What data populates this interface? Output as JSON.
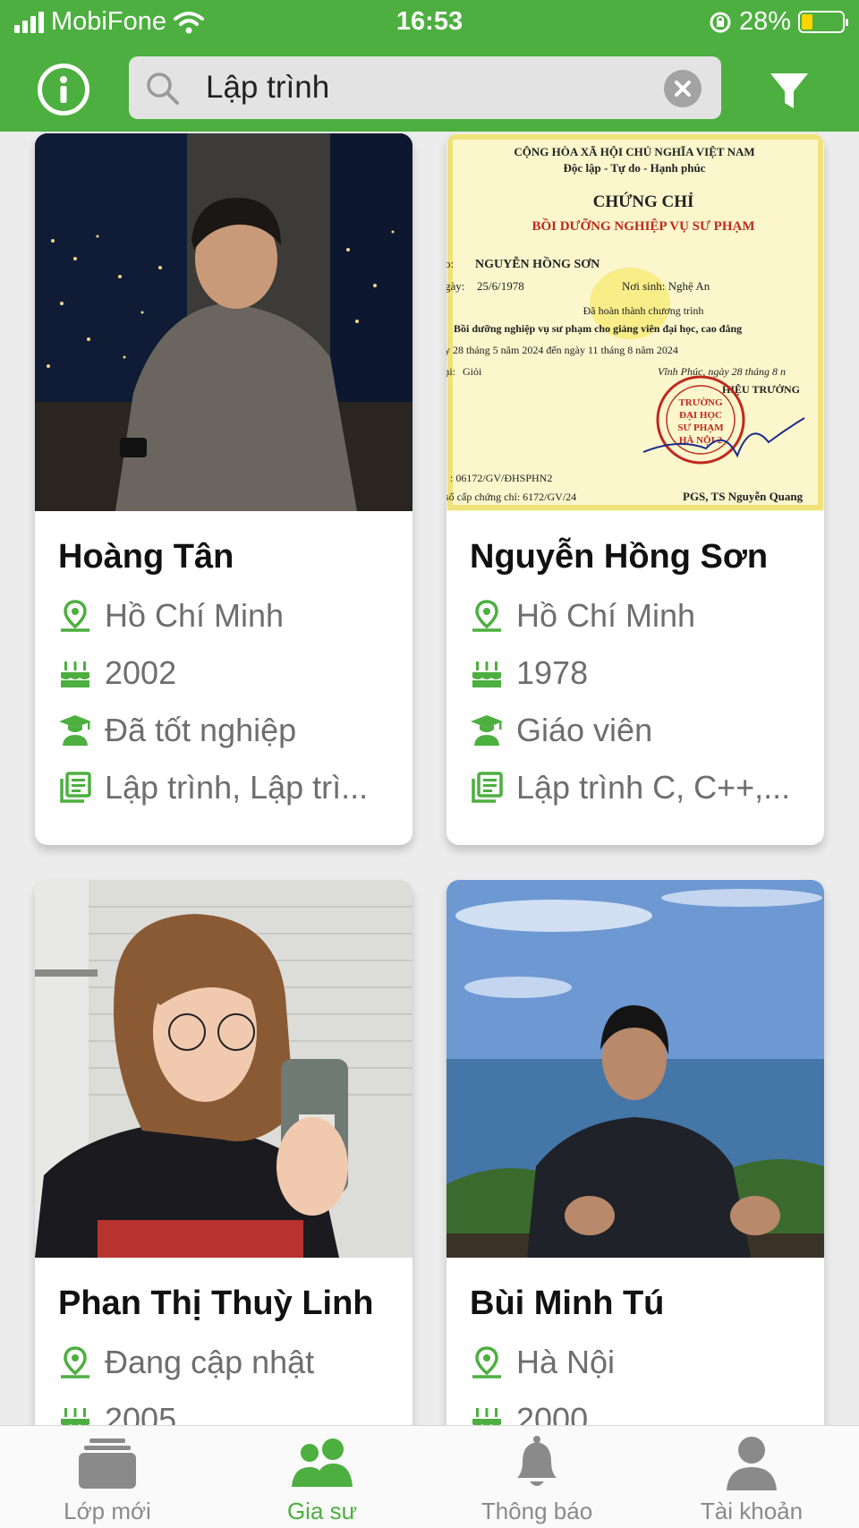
{
  "status_bar": {
    "carrier": "MobiFone",
    "time": "16:53",
    "battery": "28%",
    "battery_level": 0.28
  },
  "search": {
    "value": "Lập trình",
    "placeholder": ""
  },
  "colors": {
    "brand": "#4caf3f",
    "icon_green": "#4caf3f",
    "text_secondary": "#6e6e6e"
  },
  "tutors": [
    {
      "name": "Hoàng Tân",
      "location": "Hồ Chí Minh",
      "birth_year": "2002",
      "education": "Đã tốt nghiệp",
      "subjects": "Lập trình, Lập trì..."
    },
    {
      "name": "Nguyễn Hồng Sơn",
      "location": "Hồ Chí Minh",
      "birth_year": "1978",
      "education": "Giáo viên",
      "subjects": "Lập trình C, C++,..."
    },
    {
      "name": "Phan Thị Thuỳ Linh",
      "location": "Đang cập nhật",
      "birth_year": "2005"
    },
    {
      "name": "Bùi Minh Tú",
      "location": "Hà Nội",
      "birth_year": "2000"
    }
  ],
  "certificate": {
    "line1": "CỘNG HÒA XÃ HỘI CHỦ NGHĨA VIỆT NAM",
    "line2": "Độc lập - Tự do - Hạnh phúc",
    "title": "CHỨNG CHỈ",
    "subtitle": "BỒI DƯỠNG NGHIỆP VỤ SƯ PHẠM",
    "holder": "NGUYỄN HỒNG SƠN",
    "dob": "25/6/1978",
    "birthplace": "Nơi sinh: Nghệ An",
    "completed": "Đã hoàn thành chương trình",
    "program": "Bồi dưỡng nghiệp vụ sư phạm cho giảng viên đại học, cao đẳng",
    "period": "y 28 tháng 5 năm 2024 đến ngày 11 tháng 8 năm 2024",
    "grade": "Giỏi",
    "place_date": "Vĩnh Phúc, ngày 28 tháng 8 n",
    "principal": "HIỆU TRƯỞNG",
    "number": ": 06172/GV/ĐHSPHN2",
    "registry": "số cấp chứng chỉ: 6172/GV/24",
    "signer": "PGS, TS Nguyễn Quang"
  },
  "tabs": [
    {
      "label": "Lớp mới",
      "icon": "stack-icon",
      "active": false
    },
    {
      "label": "Gia sư",
      "icon": "people-icon",
      "active": true
    },
    {
      "label": "Thông báo",
      "icon": "bell-icon",
      "active": false
    },
    {
      "label": "Tài khoản",
      "icon": "person-icon",
      "active": false
    }
  ]
}
